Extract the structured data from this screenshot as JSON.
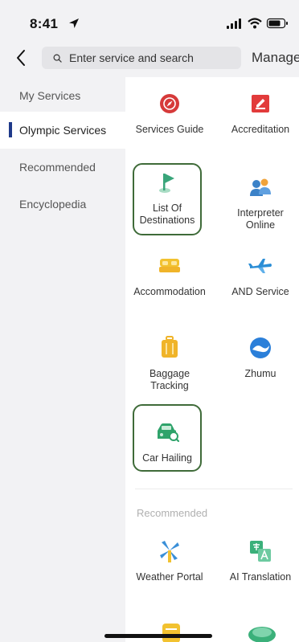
{
  "status_bar": {
    "time": "8:41"
  },
  "header": {
    "search_placeholder": "Enter service and search",
    "manage_label": "Manage"
  },
  "sidebar": {
    "items": [
      {
        "label": "My Services",
        "active": false
      },
      {
        "label": "Olympic Services",
        "active": true
      },
      {
        "label": "Recommended",
        "active": false
      },
      {
        "label": "Encyclopedia",
        "active": false
      }
    ]
  },
  "services": [
    {
      "label": "Services Guide",
      "icon": "compass-icon",
      "color": "#d63a3a"
    },
    {
      "label": "Accreditation",
      "icon": "edit-icon",
      "color": "#e23b3b"
    },
    {
      "label": "List Of Destinations",
      "icon": "flag-icon",
      "color": "#39a57a"
    },
    {
      "label": "Interpreter Online",
      "icon": "interpreter-icon",
      "color": "#3b82c8"
    },
    {
      "label": "Accommodation",
      "icon": "bed-icon",
      "color": "#f2c230"
    },
    {
      "label": "AND Service",
      "icon": "plane-icon",
      "color": "#2b8ed6"
    },
    {
      "label": "Baggage Tracking",
      "icon": "luggage-icon",
      "color": "#f0b429"
    },
    {
      "label": "Zhumu",
      "icon": "zhumu-icon",
      "color": "#2b7fd9"
    },
    {
      "label": "Car Hailing",
      "icon": "car-icon",
      "color": "#2fa36b"
    }
  ],
  "recommended": {
    "title": "Recommended",
    "items": [
      {
        "label": "Weather Portal",
        "icon": "windmill-icon",
        "color": "#3a8fd8"
      },
      {
        "label": "AI Translation",
        "icon": "translate-icon",
        "color": "#3bb07a"
      }
    ]
  },
  "colors": {
    "active_indicator": "#1f3a8a",
    "highlight_border": "#3f6b39"
  }
}
